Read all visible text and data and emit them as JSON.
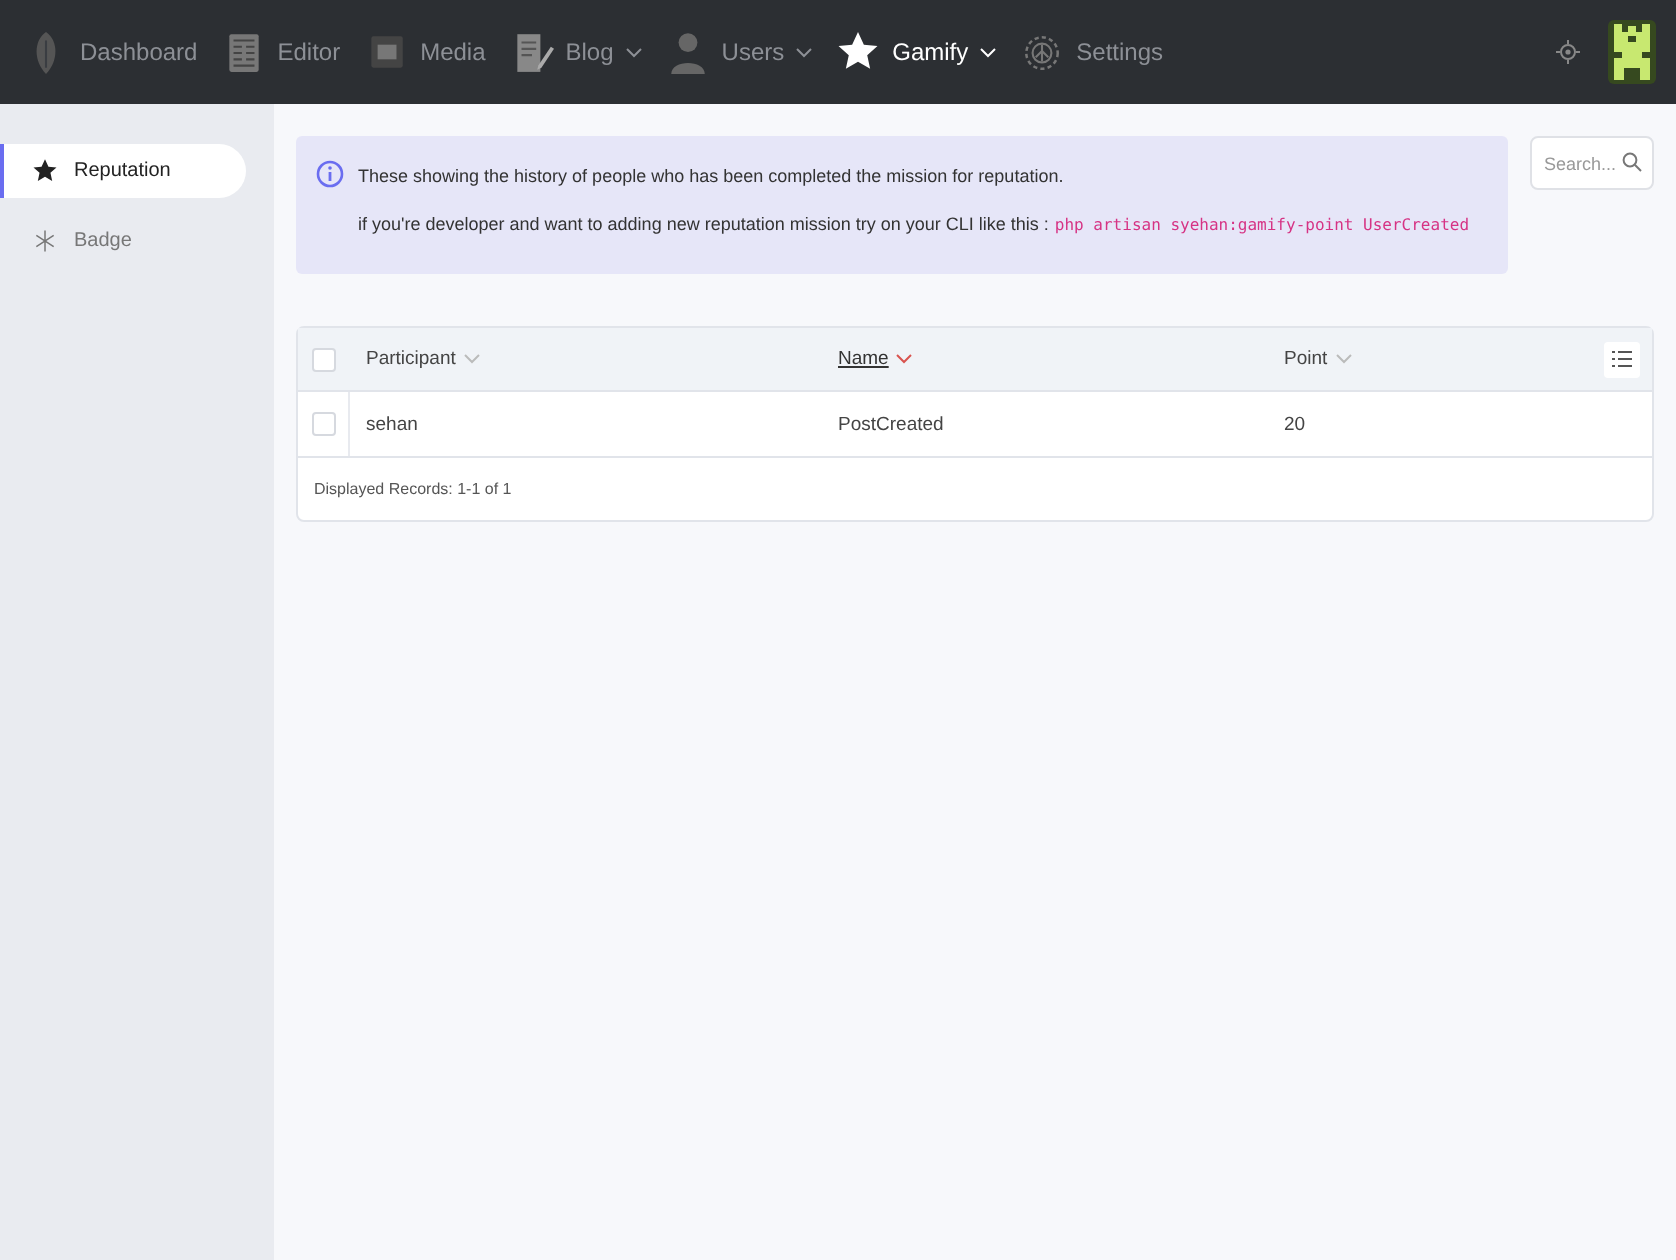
{
  "nav": [
    {
      "label": "Dashboard",
      "kind": "leaf",
      "dropdown": false,
      "selected": false
    },
    {
      "label": "Editor",
      "kind": "newspaper",
      "dropdown": false,
      "selected": false
    },
    {
      "label": "Media",
      "kind": "image",
      "dropdown": false,
      "selected": false
    },
    {
      "label": "Blog",
      "kind": "document",
      "dropdown": true,
      "selected": false
    },
    {
      "label": "Users",
      "kind": "person",
      "dropdown": true,
      "selected": false
    },
    {
      "label": "Gamify",
      "kind": "star",
      "dropdown": true,
      "selected": true
    },
    {
      "label": "Settings",
      "kind": "gear",
      "dropdown": false,
      "selected": false
    }
  ],
  "sidebar": {
    "items": [
      {
        "label": "Reputation",
        "kind": "star",
        "selected": true
      },
      {
        "label": "Badge",
        "kind": "asterisk",
        "selected": false
      }
    ]
  },
  "notice": {
    "line_1": "These showing the history of people who has been completed the mission for reputation.",
    "line_2": "if you're developer and want to adding new reputation mission try on your CLI like this :",
    "command": "php artisan syehan:gamify-point UserCreated"
  },
  "search": {
    "placeholder": "Search..."
  },
  "table": {
    "columns": [
      {
        "label": "Participant",
        "sorted": false
      },
      {
        "label": "Name",
        "sorted": true
      },
      {
        "label": "Point",
        "sorted": false
      }
    ],
    "header_checked": false,
    "rows": [
      {
        "checked": false,
        "cells": [
          "sehan",
          "PostCreated",
          "20"
        ]
      }
    ],
    "footer": "Displayed Records: 1-1 of 1"
  }
}
